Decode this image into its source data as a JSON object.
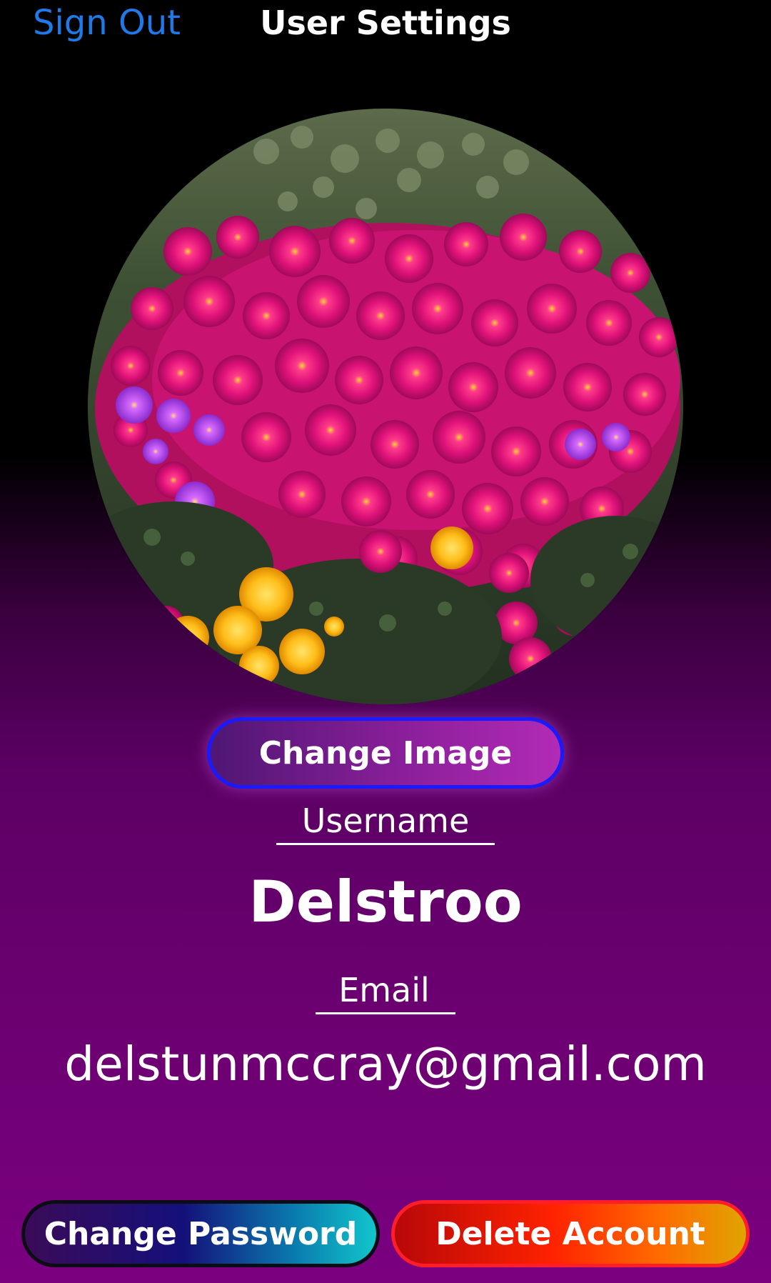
{
  "header": {
    "sign_out_label": "Sign Out",
    "title": "User Settings"
  },
  "profile": {
    "change_image_label": "Change Image",
    "username_label": "Username",
    "username": "Delstroo",
    "email_label": "Email",
    "email": "delstunmccray@gmail.com"
  },
  "actions": {
    "change_password_label": "Change Password",
    "delete_account_label": "Delete Account"
  },
  "colors": {
    "link_blue": "#1f7ae8",
    "background_purple": "#7a0080",
    "delete_red": "#ff1d2a"
  }
}
